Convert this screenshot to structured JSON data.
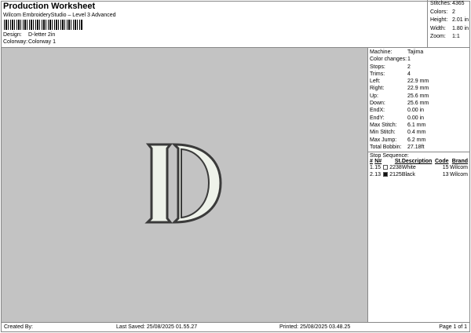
{
  "header": {
    "title": "Production Worksheet",
    "subtitle": "Wilcom EmbroideryStudio – Level 3 Advanced",
    "design_label": "Design:",
    "design_value": "D-letter 2in",
    "colorway_label": "Colorway:",
    "colorway_value": "Colorway 1"
  },
  "summary": [
    {
      "label": "Stitches:",
      "value": "4365"
    },
    {
      "label": "Colors:",
      "value": "2"
    },
    {
      "label": "Height:",
      "value": "2.01 in"
    },
    {
      "label": "Width:",
      "value": "1.80 in"
    },
    {
      "label": "Zoom:",
      "value": "1:1"
    }
  ],
  "details": [
    {
      "label": "Machine:",
      "value": "Tajima"
    },
    {
      "label": "Color changes:",
      "value": "1"
    },
    {
      "label": "Stops:",
      "value": "2"
    },
    {
      "label": "Trims:",
      "value": "4"
    },
    {
      "label": "Left:",
      "value": "22.9 mm"
    },
    {
      "label": "Right:",
      "value": "22.9 mm"
    },
    {
      "label": "Up:",
      "value": "25.6 mm"
    },
    {
      "label": "Down:",
      "value": "25.6 mm"
    },
    {
      "label": "EndX:",
      "value": "0.00 in"
    },
    {
      "label": "EndY:",
      "value": "0.00 in"
    },
    {
      "label": "Max Stitch:",
      "value": "6.1 mm"
    },
    {
      "label": "Min Stitch:",
      "value": "0.4 mm"
    },
    {
      "label": "Max Jump:",
      "value": "6.2 mm"
    },
    {
      "label": "Total Bobbin:",
      "value": "27.18ft"
    }
  ],
  "stop_sequence": {
    "title": "Stop Sequence:",
    "headers": [
      "#",
      "N#",
      "St.",
      "Description",
      "Code",
      "Brand"
    ],
    "rows": [
      {
        "num": "1.",
        "n": "15",
        "color": "#ffffff",
        "st": "2238",
        "desc": "White",
        "code": "15",
        "brand": "Wilcom"
      },
      {
        "num": "2.",
        "n": "13",
        "color": "#111111",
        "st": "2125",
        "desc": "Black",
        "code": "13",
        "brand": "Wilcom"
      }
    ]
  },
  "footer": {
    "created": "Created By:",
    "saved": "Last Saved: 25/08/2025 01.55.27",
    "printed": "Printed: 25/08/2025 03.48.25",
    "page": "Page 1 of 1"
  },
  "colors": {
    "canvas": "#c3c3c3",
    "fill": "#eef2ea",
    "outline": "#3a3a3a"
  }
}
